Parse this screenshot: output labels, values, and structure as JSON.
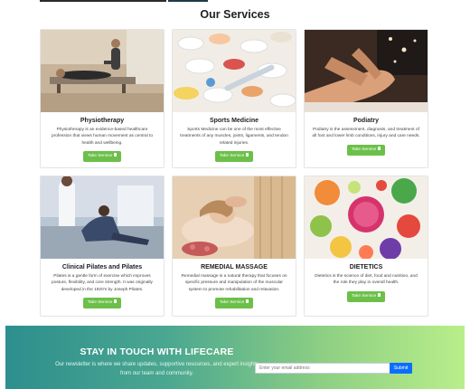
{
  "section_title": "Our Services",
  "services": [
    {
      "title": "Physiotherapy",
      "description": "Physiotherapy is an evidence-based healthcare profession that views human movement as central to health and wellbeing.",
      "button": "Take Service"
    },
    {
      "title": "Sports Medicine",
      "description": "Sports Medicine can be one of the most effective treatments of any muscles, joints, ligaments, and tendon related injuries.",
      "button": "Take Service"
    },
    {
      "title": "Podiatry",
      "description": "Podiatry is the assessment, diagnosis, and treatment of all foot and lower limb conditions, injury and care needs.",
      "button": "Take Service"
    },
    {
      "title": "Clinical Pilates and Pilates",
      "description": "Pilates is a gentle form of exercise which improves posture, flexibility, and core strength. It was originally developed in the 1920’s by Joseph Pilates.",
      "button": "Take Service"
    },
    {
      "title": "REMEDIAL MASSAGE",
      "description": "Remedial massage is a natural therapy that focuses on specific pressure and manipulation of the muscular system to promote rehabilitation and relaxation.",
      "button": "Take Service"
    },
    {
      "title": "DIETETICS",
      "description": "Dietetics is the science of diet, food and nutrition, and the role they play in overall health.",
      "button": "Take Service"
    }
  ],
  "newsletter": {
    "title": "STAY IN TOUCH WITH LIFECARE",
    "text": "Our newsletter is where we share updates, supportive resources, and expert insights from our team and community.",
    "input_placeholder": "Enter your email address",
    "button": "Submit"
  },
  "colors": {
    "button_green": "#6cc04a",
    "submit_blue": "#0d6efd"
  }
}
